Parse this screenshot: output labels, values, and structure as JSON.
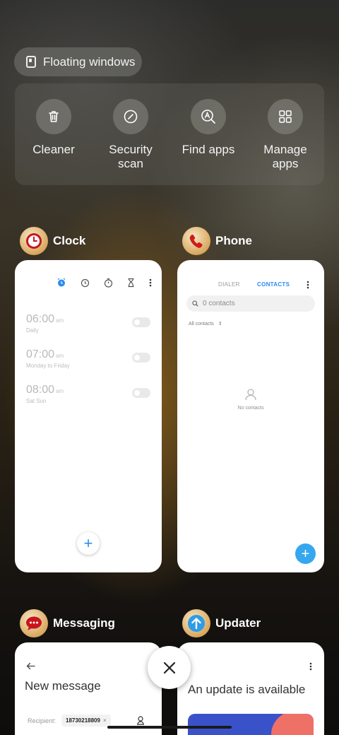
{
  "floating_windows": {
    "label": "Floating windows"
  },
  "tools": [
    {
      "label": "Cleaner",
      "icon": "trash-icon"
    },
    {
      "label": "Security\nscan",
      "icon": "security-scan-icon"
    },
    {
      "label": "Find apps",
      "icon": "find-apps-icon"
    },
    {
      "label": "Manage\napps",
      "icon": "grid-icon"
    }
  ],
  "apps": {
    "clock": {
      "name": "Clock",
      "alarms": [
        {
          "time": "06:00",
          "ampm": "am",
          "repeat": "Daily"
        },
        {
          "time": "07:00",
          "ampm": "am",
          "repeat": "Monday to Friday"
        },
        {
          "time": "08:00",
          "ampm": "am",
          "repeat": "Sat Sun"
        }
      ],
      "add_symbol": "+"
    },
    "phone": {
      "name": "Phone",
      "tabs": [
        "DIALER",
        "CONTACTS"
      ],
      "search_placeholder": "0 contacts",
      "filter": "All contacts",
      "empty": "No contacts",
      "add_symbol": "+"
    },
    "messaging": {
      "name": "Messaging",
      "title": "New message",
      "recipient_label": "Recipient:",
      "recipient_value": "18730218809",
      "chip_remove": "×"
    },
    "updater": {
      "name": "Updater",
      "title": "An update is available"
    }
  },
  "colors": {
    "accent_blue": "#2a8cf0",
    "fab_blue": "#35a7ee",
    "clock_red": "#c8161d"
  }
}
